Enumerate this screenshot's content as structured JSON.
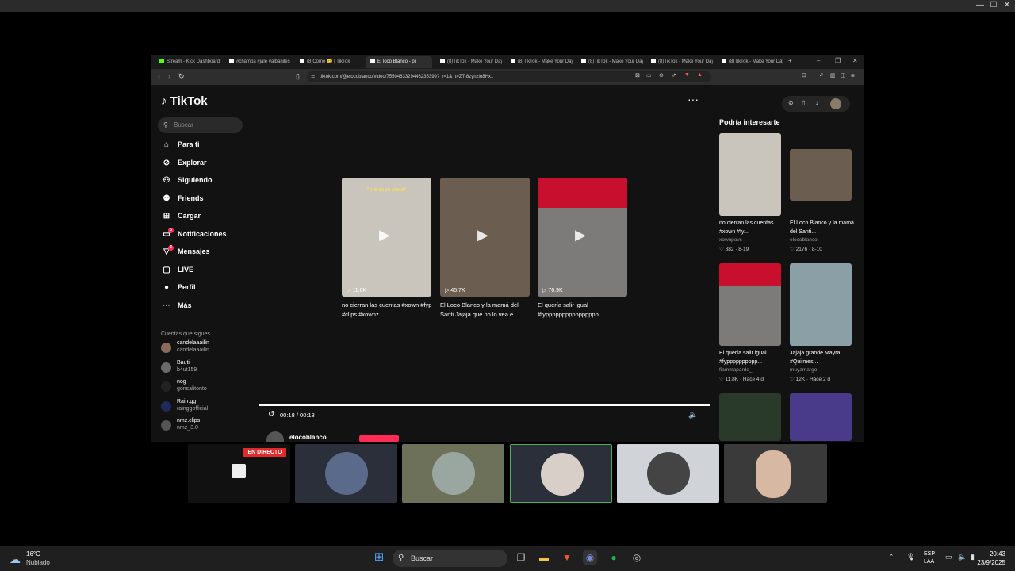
{
  "browser": {
    "tabs": [
      {
        "label": "Stream - Kick Dashboard",
        "color": "#53fc18"
      },
      {
        "label": "#chamba #jale #albañiles",
        "color": "#ffffff"
      },
      {
        "label": "(8)Come 😊 | TikTok",
        "color": "#ffffff"
      },
      {
        "label": "El loco Blanco - pi",
        "color": "#ffffff",
        "active": true
      },
      {
        "label": "(8)TikTok - Make Your Day",
        "color": "#ffffff"
      },
      {
        "label": "(8)TikTok - Make Your Day",
        "color": "#ffffff"
      },
      {
        "label": "(8)TikTok - Make Your Day",
        "color": "#ffffff"
      },
      {
        "label": "(8)TikTok - Make Your Day",
        "color": "#ffffff"
      },
      {
        "label": "(8)TikTok - Make Your Day",
        "color": "#ffffff"
      }
    ],
    "url": "tiktok.com/@elocoblanco/video/7550463329446235399?_r=1&_t=ZT-8zynzlo8Hx1"
  },
  "tiktok": {
    "logo": "TikTok",
    "search_placeholder": "Buscar",
    "nav": [
      {
        "label": "Para ti",
        "icon": "home-icon",
        "glyph": "⌂"
      },
      {
        "label": "Explorar",
        "icon": "compass-icon",
        "glyph": "⊘"
      },
      {
        "label": "Siguiendo",
        "icon": "following-icon",
        "glyph": "⚇"
      },
      {
        "label": "Friends",
        "icon": "friends-icon",
        "glyph": "⚉"
      },
      {
        "label": "Cargar",
        "icon": "upload-icon",
        "glyph": "⊞"
      },
      {
        "label": "Notificaciones",
        "icon": "inbox-icon",
        "glyph": "▭",
        "badge": "5"
      },
      {
        "label": "Mensajes",
        "icon": "send-icon",
        "glyph": "▽",
        "badge": "3"
      },
      {
        "label": "LIVE",
        "icon": "live-icon",
        "glyph": "▢"
      },
      {
        "label": "Perfil",
        "icon": "avatar-icon",
        "glyph": "●"
      },
      {
        "label": "Más",
        "icon": "more-icon",
        "glyph": "···"
      }
    ],
    "following_header": "Cuentas que sigues",
    "following": [
      {
        "name": "candelaaailin",
        "handle": "candelaaailin",
        "color": "#8a6a5a"
      },
      {
        "name": "Bauti",
        "handle": "b4ut159",
        "color": "#6a6a6a"
      },
      {
        "name": "nog",
        "handle": "gonsalitonto",
        "color": "#222222"
      },
      {
        "name": "Rain.gg",
        "handle": "rainggofficial",
        "color": "#1e2a5a"
      },
      {
        "name": "nmz.clips",
        "handle": "nmz_3.0",
        "color": "#555555"
      }
    ],
    "videos": [
      {
        "title": "no cierran las cuentas #xown #fyp #clips #xownz...",
        "views": "11.6K",
        "bg": "#c9c5bc",
        "caption": "*me cobo plata*"
      },
      {
        "title": "El Loco Blanco y la mamá del Santi Jajaja que no lo vea e...",
        "views": "45.7K",
        "bg": "#6b5d50"
      },
      {
        "title": "El quería salir igual #fypppppppppppppppp...",
        "views": "76.9K",
        "bg": "#7d7b7a"
      }
    ],
    "player": {
      "time": "00:18 / 00:18",
      "author": "elocoblanco"
    },
    "suggested_header": "Podría interesarte",
    "suggested": [
      {
        "title": "no cierran las cuentas #xown #fy...",
        "user": "xownpovs",
        "stats": "♡ 882 · 8-19",
        "bg": "#c9c5bc"
      },
      {
        "title": "El Loco Blanco y la mamá del Santi...",
        "user": "elocoblanco",
        "stats": "♡ 2176 · 8-10",
        "bg": "#6b5d50"
      },
      {
        "title": "El quería salir igual #fypppppppppp...",
        "user": "fiammapardo_",
        "stats": "♡ 11.8K · Hace 4 d",
        "bg": "#7d7b7a"
      },
      {
        "title": "Jajaja grande Mayra. #Quilmes...",
        "user": "muyamargo",
        "stats": "♡ 12K · Hace 2 d",
        "bg": "#8aa0a6"
      },
      {
        "title": "",
        "user": "",
        "stats": "",
        "bg": "#2a3a2a"
      },
      {
        "title": "",
        "user": "",
        "stats": "",
        "bg": "#4a3a8a"
      }
    ]
  },
  "stream": {
    "live_label": "EN DIRECTO"
  },
  "taskbar": {
    "weather_temp": "16°C",
    "weather_desc": "Nublado",
    "search": "Buscar",
    "lang1": "ESP",
    "lang2": "LAA",
    "time": "20:43",
    "date": "23/9/2025"
  }
}
